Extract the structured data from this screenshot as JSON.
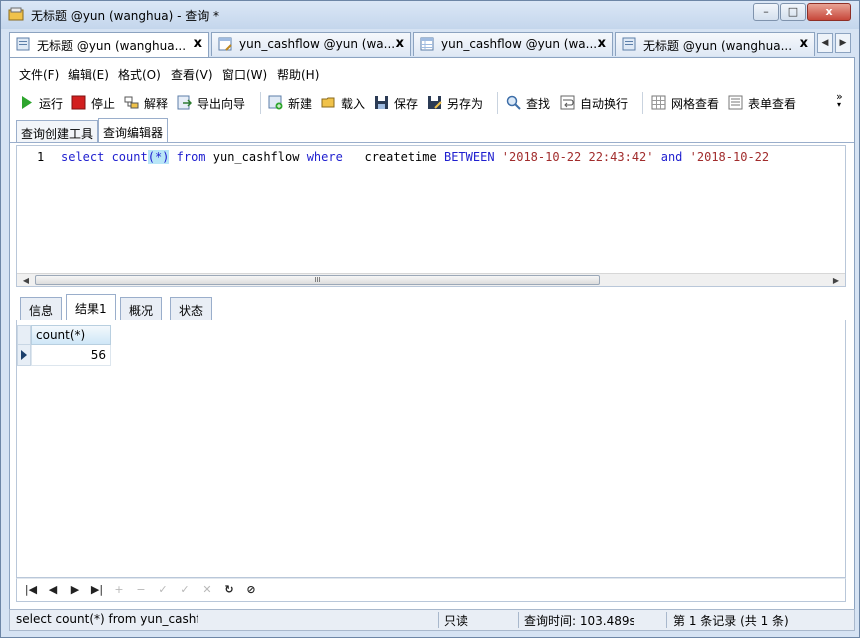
{
  "window": {
    "title": "无标题 @yun (wanghua) - 查询 *",
    "controls": {
      "minimize": "–",
      "maximize": "□",
      "close": "x"
    }
  },
  "doc_tabs": [
    {
      "label": "无标题 @yun (wanghua...",
      "close": "x",
      "active": true
    },
    {
      "label": "yun_cashflow @yun (wa...",
      "close": "x",
      "active": false
    },
    {
      "label": "yun_cashflow @yun (wa...",
      "close": "x",
      "active": false
    },
    {
      "label": "无标题 @yun (wanghua...",
      "close": "x",
      "active": false
    }
  ],
  "tab_nav": {
    "prev": "◀",
    "next": "▶"
  },
  "menu": [
    "文件(F)",
    "编辑(E)",
    "格式(O)",
    "查看(V)",
    "窗口(W)",
    "帮助(H)"
  ],
  "toolbar": {
    "run": "运行",
    "stop": "停止",
    "explain": "解释",
    "export_wizard": "导出向导",
    "new": "新建",
    "load": "载入",
    "save": "保存",
    "save_as": "另存为",
    "find": "查找",
    "word_wrap": "自动换行",
    "grid_view": "网格查看",
    "form_view": "表单查看",
    "overflow": "»"
  },
  "sub_tabs": [
    "查询创建工具",
    "查询编辑器"
  ],
  "editor": {
    "line_number": "1",
    "code": {
      "t1": "select",
      "t2": " count",
      "t3": "(*)",
      "t4": " from",
      "t5": " yun_cashflow ",
      "t6": "where",
      "t7": "   createtime ",
      "t8": "BETWEEN",
      "t9": " ",
      "t10": "'2018-10-22 22:43:42'",
      "t11": " ",
      "t12": "and",
      "t13": " ",
      "t14": "'2018-10-22"
    },
    "scroll_grip": "III"
  },
  "result_tabs": [
    "信息",
    "结果1",
    "概况",
    "状态"
  ],
  "grid": {
    "columns": [
      "count(*)"
    ],
    "rows": [
      [
        "56"
      ]
    ]
  },
  "navigator": {
    "first": "|◀",
    "prev": "◀",
    "next": "▶",
    "last": "▶|",
    "add": "+",
    "delete": "−",
    "apply": "✓",
    "confirm": "✓",
    "cancel": "✕",
    "refresh": "↻",
    "stop": "⊘"
  },
  "status_bar": {
    "sql": "select count(*) from yun_cashflo",
    "mode": "只读",
    "query_time": "查询时间: 103.489s",
    "record": "第 1 条记录 (共 1 条)"
  },
  "colors": {
    "keyword": "#1f1fcf",
    "string": "#a12c2c",
    "bracket_highlight": "#b8e6f7",
    "run_green": "#2ea52e",
    "stop_red": "#d21f1f"
  }
}
